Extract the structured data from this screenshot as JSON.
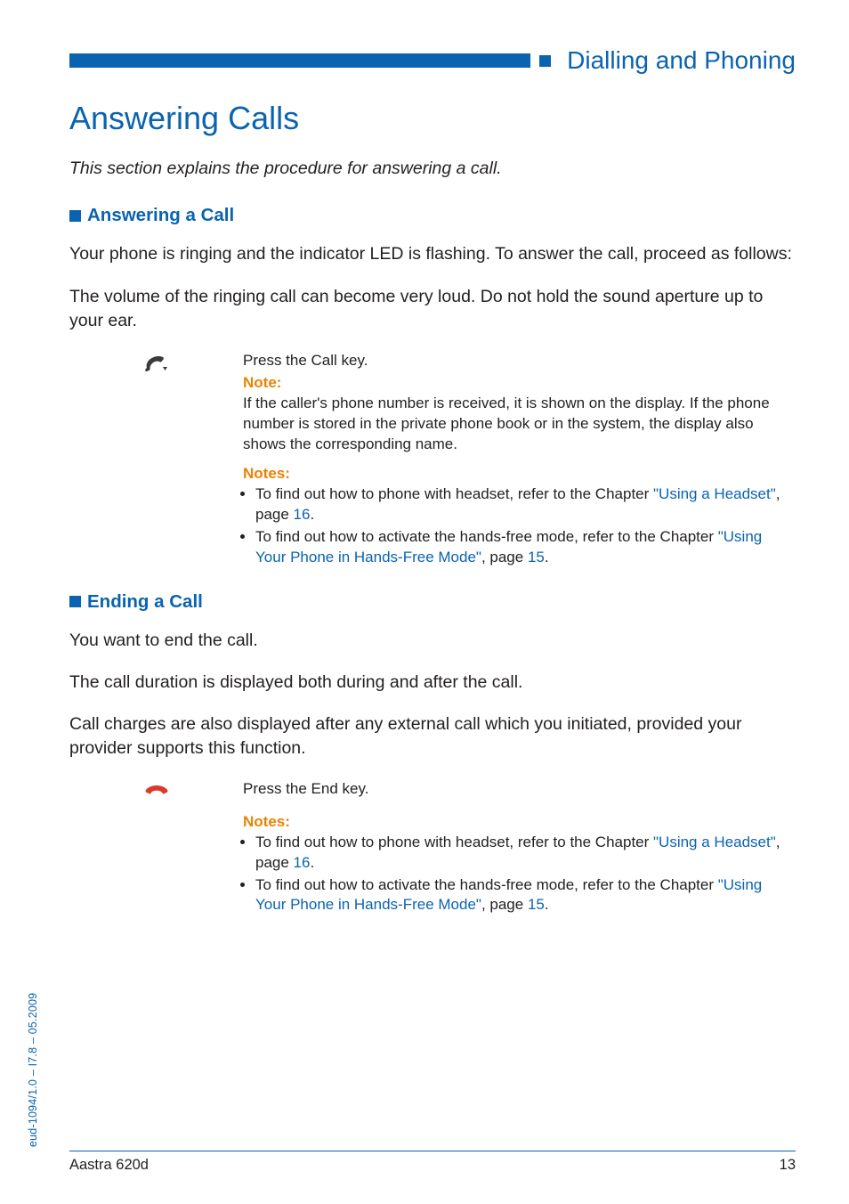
{
  "header": {
    "section_title": "Dialling and Phoning"
  },
  "title": "Answering Calls",
  "intro": "This section explains the procedure for answering a call.",
  "sections": {
    "answering": {
      "heading": "Answering a Call",
      "p1": "Your phone is ringing and the indicator LED is flashing. To answer the call, proceed as follows:",
      "p2": "The volume of the ringing call can become very loud. Do not hold the sound aperture up to your ear.",
      "icon_name": "call-key-icon",
      "instr": "Press the Call key.",
      "note_label": "Note:",
      "note_text": "If the caller's phone number is received, it is shown on the display. If the phone number is stored in the private phone book or in the system, the display also shows the corresponding name.",
      "notes_label": "Notes:",
      "notes": {
        "item1_pre": "To find out how to phone with headset, refer to the Chapter ",
        "item1_link": "\"Using a Headset\"",
        "item1_mid": ", page ",
        "item1_page": "16",
        "item1_post": ".",
        "item2_pre": "To find out how to activate the hands-free mode, refer to the Chapter ",
        "item2_link": "\"Using Your Phone in Hands-Free Mode\"",
        "item2_mid": ", page ",
        "item2_page": "15",
        "item2_post": "."
      }
    },
    "ending": {
      "heading": "Ending a Call",
      "p1": "You want to end the call.",
      "p2": "The call duration is displayed both during and after the call.",
      "p3": "Call charges are also displayed after any external call which you initiated, provided your provider supports this function.",
      "icon_name": "end-key-icon",
      "instr": "Press the End key.",
      "notes_label": "Notes:",
      "notes": {
        "item1_pre": "To find out how to phone with headset, refer to the Chapter ",
        "item1_link": "\"Using a Headset\"",
        "item1_mid": ", page ",
        "item1_page": "16",
        "item1_post": ".",
        "item2_pre": "To find out how to activate the hands-free mode, refer to the Chapter ",
        "item2_link": "\"Using Your Phone in Hands-Free Mode\"",
        "item2_mid": ", page ",
        "item2_page": "15",
        "item2_post": "."
      }
    }
  },
  "footer": {
    "left": "Aastra 620d",
    "right": "13"
  },
  "side_text": "eud-1094/1.0 – I7.8 – 05.2009"
}
